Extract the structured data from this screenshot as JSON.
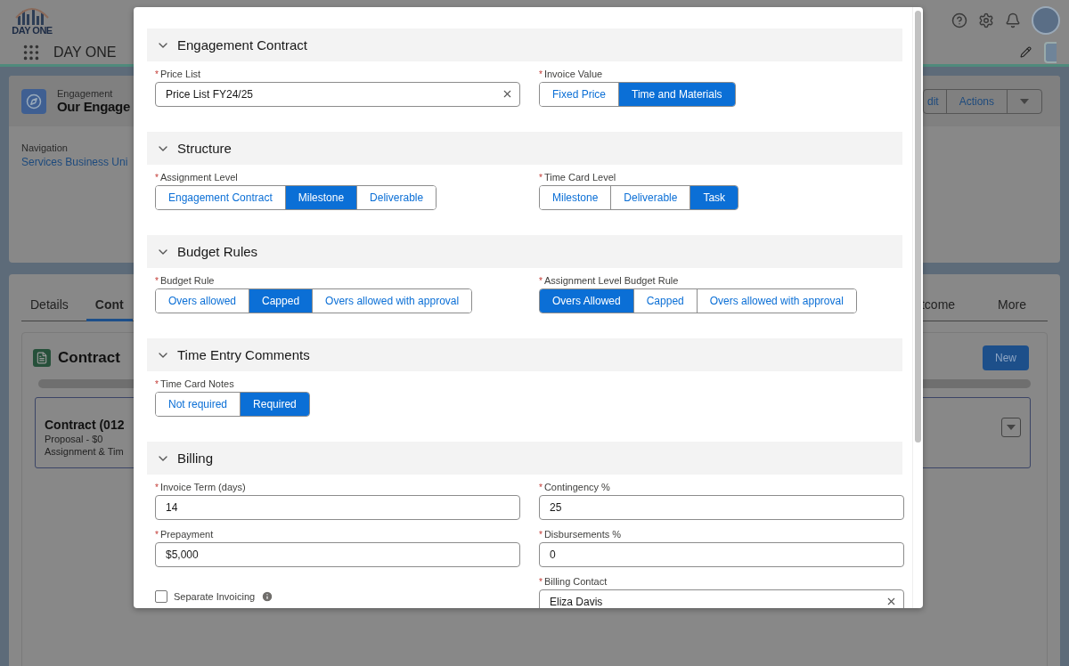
{
  "app": {
    "logo_text": "DAY ONE",
    "app_name": "DAY ONE"
  },
  "record": {
    "type": "Engagement",
    "name": "Our Engage",
    "nav_label": "Navigation",
    "nav_value": "Services Business Uni",
    "buttons": [
      "dit",
      "Actions"
    ]
  },
  "tabs": [
    {
      "label": "Details",
      "selected": false
    },
    {
      "label": "Cont",
      "selected": true
    },
    {
      "label": "tcome",
      "selected": false
    },
    {
      "label": "More",
      "selected": false
    }
  ],
  "related": {
    "title": "Contract",
    "new_button": "New",
    "card": {
      "title": "Contract (012",
      "lines": [
        "Proposal - $0",
        "Assignment & Tim"
      ]
    }
  },
  "modal": {
    "sections": [
      {
        "title": "Engagement Contract",
        "expanded": true,
        "fields": [
          {
            "kind": "lookup",
            "label": "Price List",
            "marker": "*",
            "value": "Price List FY24/25"
          },
          {
            "kind": "toggle",
            "label": "Invoice Value",
            "marker": "*",
            "options": [
              {
                "label": "Fixed Price",
                "selected": false
              },
              {
                "label": "Time and Materials",
                "selected": true
              }
            ]
          }
        ]
      },
      {
        "title": "Structure",
        "expanded": true,
        "fields": [
          {
            "kind": "toggle",
            "label": "Assignment Level",
            "marker": "*",
            "options": [
              {
                "label": "Engagement Contract",
                "selected": false
              },
              {
                "label": "Milestone",
                "selected": true
              },
              {
                "label": "Deliverable",
                "selected": false
              }
            ]
          },
          {
            "kind": "toggle",
            "label": "Time Card Level",
            "marker": "*",
            "options": [
              {
                "label": "Milestone",
                "selected": false
              },
              {
                "label": "Deliverable",
                "selected": false
              },
              {
                "label": "Task",
                "selected": true
              }
            ]
          }
        ]
      },
      {
        "title": "Budget Rules",
        "expanded": true,
        "fields": [
          {
            "kind": "toggle",
            "label": "Budget Rule",
            "marker": "*",
            "options": [
              {
                "label": "Overs allowed",
                "selected": false
              },
              {
                "label": "Capped",
                "selected": true
              },
              {
                "label": "Overs allowed with approval",
                "selected": false
              }
            ]
          },
          {
            "kind": "toggle",
            "label": "Assignment Level Budget Rule",
            "marker": "*",
            "options": [
              {
                "label": "Overs Allowed",
                "selected": true
              },
              {
                "label": "Capped",
                "selected": false
              },
              {
                "label": "Overs allowed with approval",
                "selected": false
              }
            ]
          }
        ]
      },
      {
        "title": "Time Entry Comments",
        "expanded": true,
        "fields": [
          {
            "kind": "toggle",
            "label": "Time Card Notes",
            "marker": "*",
            "options": [
              {
                "label": "Not required",
                "selected": false
              },
              {
                "label": "Required",
                "selected": true
              }
            ]
          }
        ]
      },
      {
        "title": "Billing",
        "expanded": true,
        "fields": [
          {
            "kind": "text",
            "label": "Invoice Term (days)",
            "marker": "*",
            "value": "14"
          },
          {
            "kind": "text",
            "label": "Contingency %",
            "marker": "*",
            "value": "25"
          },
          {
            "kind": "text",
            "label": "Prepayment",
            "marker": "*",
            "value": "$5,000"
          },
          {
            "kind": "text",
            "label": "Disbursements %",
            "marker": "*",
            "value": "0"
          },
          {
            "kind": "checkbox",
            "label": "Separate Invoicing",
            "checked": false,
            "info": true
          },
          {
            "kind": "lookup",
            "label": "Billing Contact",
            "marker": "*",
            "value": "Eliza Davis"
          }
        ]
      }
    ]
  }
}
